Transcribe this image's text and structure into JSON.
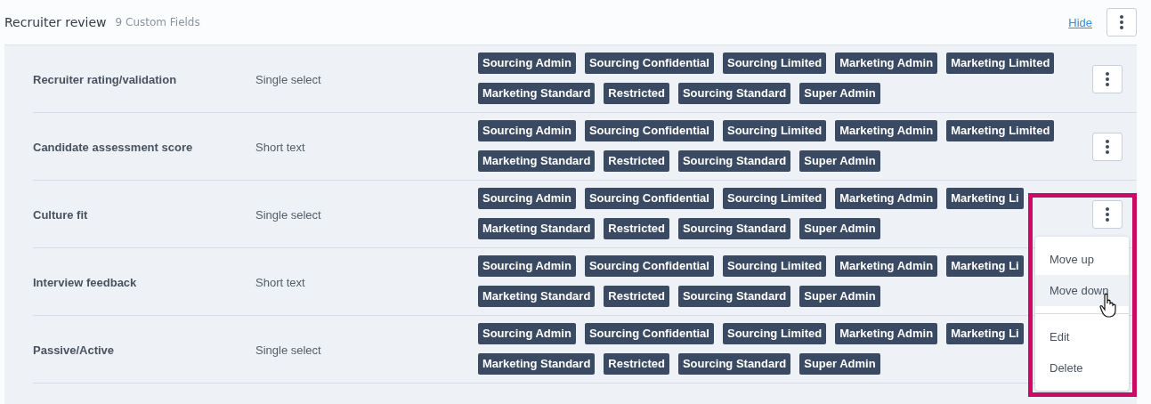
{
  "section": {
    "title": "Recruiter review",
    "count": "9 Custom Fields",
    "hide_link": "Hide"
  },
  "rows": [
    {
      "name": "Recruiter rating/validation",
      "type": "Single select",
      "menu_button": true,
      "tag_lines": [
        [
          "Sourcing Admin",
          "Sourcing Confidential",
          "Sourcing Limited",
          "Marketing Admin",
          "Marketing Limited"
        ],
        [
          "Marketing Standard",
          "Restricted",
          "Sourcing Standard",
          "Super Admin"
        ]
      ]
    },
    {
      "name": "Candidate assessment score",
      "type": "Short text",
      "menu_button": true,
      "tag_lines": [
        [
          "Sourcing Admin",
          "Sourcing Confidential",
          "Sourcing Limited",
          "Marketing Admin",
          "Marketing Limited"
        ],
        [
          "Marketing Standard",
          "Restricted",
          "Sourcing Standard",
          "Super Admin"
        ]
      ]
    },
    {
      "name": "Culture fit",
      "type": "Single select",
      "menu_button": true,
      "tag_lines": [
        [
          "Sourcing Admin",
          "Sourcing Confidential",
          "Sourcing Limited",
          "Marketing Admin",
          "Marketing Li"
        ],
        [
          "Marketing Standard",
          "Restricted",
          "Sourcing Standard",
          "Super Admin"
        ]
      ]
    },
    {
      "name": "Interview feedback",
      "type": "Short text",
      "menu_button": false,
      "tag_lines": [
        [
          "Sourcing Admin",
          "Sourcing Confidential",
          "Sourcing Limited",
          "Marketing Admin",
          "Marketing Li"
        ],
        [
          "Marketing Standard",
          "Restricted",
          "Sourcing Standard",
          "Super Admin"
        ]
      ]
    },
    {
      "name": "Passive/Active",
      "type": "Single select",
      "menu_button": false,
      "tag_lines": [
        [
          "Sourcing Admin",
          "Sourcing Confidential",
          "Sourcing Limited",
          "Marketing Admin",
          "Marketing Li"
        ],
        [
          "Marketing Standard",
          "Restricted",
          "Sourcing Standard",
          "Super Admin"
        ]
      ]
    }
  ],
  "context_menu": {
    "items": [
      {
        "label": "Move up",
        "selected": false,
        "divider_after": false
      },
      {
        "label": "Move down",
        "selected": true,
        "divider_after": true
      },
      {
        "label": "Edit",
        "selected": false,
        "divider_after": false
      },
      {
        "label": "Delete",
        "selected": false,
        "divider_after": false
      }
    ]
  }
}
